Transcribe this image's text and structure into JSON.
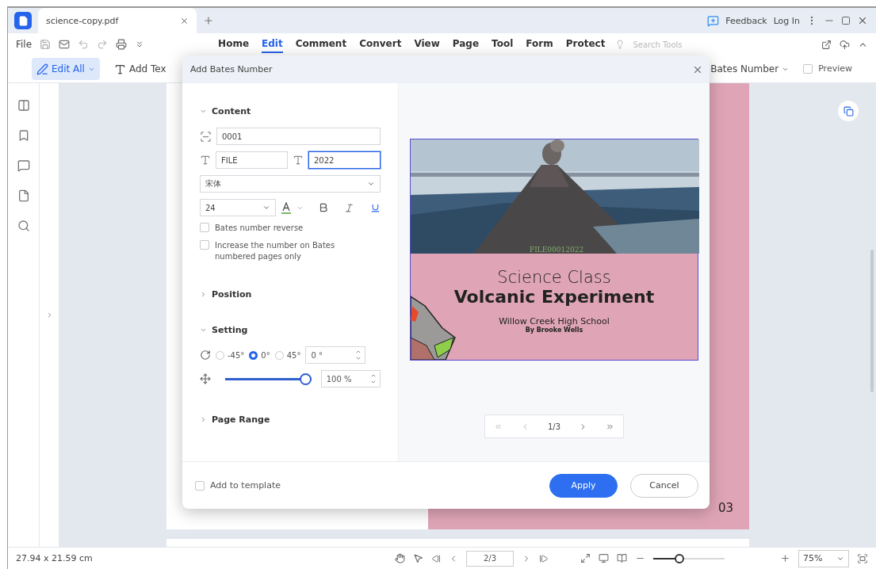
{
  "window": {
    "tab_title": "science-copy.pdf",
    "links": [
      "Feedback",
      "Log In"
    ]
  },
  "menu": {
    "file": "File",
    "tabs": [
      {
        "label": "Home",
        "selected": false
      },
      {
        "label": "Edit",
        "selected": true
      },
      {
        "label": "Comment",
        "selected": false
      },
      {
        "label": "Convert",
        "selected": false
      },
      {
        "label": "View",
        "selected": false
      },
      {
        "label": "Page",
        "selected": false
      },
      {
        "label": "Tool",
        "selected": false
      },
      {
        "label": "Form",
        "selected": false
      },
      {
        "label": "Protect",
        "selected": false
      }
    ],
    "search_placeholder": "Search Tools"
  },
  "toolbar": {
    "edit_all": {
      "label": "Edit All",
      "selected": true
    },
    "add_text": "Add Tex",
    "bates": "Bates Number",
    "preview": {
      "label": "Preview",
      "checked": false
    }
  },
  "dialog": {
    "title": "Add Bates Number",
    "content": {
      "label": "Content",
      "expanded": true,
      "number": "0001",
      "prefix": "FILE",
      "suffix": "2022",
      "font": "宋体",
      "size": "24",
      "checkboxes": [
        {
          "label": "Bates number reverse",
          "checked": false
        },
        {
          "label": "Increase the number on Bates numbered pages only",
          "checked": false
        }
      ]
    },
    "position": {
      "label": "Position",
      "expanded": false
    },
    "setting": {
      "label": "Setting",
      "expanded": true,
      "rotations": [
        {
          "label": "-45°",
          "selected": false
        },
        {
          "label": "0°",
          "selected": true
        },
        {
          "label": "45°",
          "selected": false
        }
      ],
      "angle": "0 °",
      "opacity": {
        "level": 1,
        "reading": "100 %"
      }
    },
    "page_range": {
      "label": "Page Range",
      "expanded": false
    },
    "preview": {
      "stamp": "FILE00012022",
      "title": "Science Class",
      "heading": "Volcanic Experiment",
      "school": "Willow Creek High School",
      "author": "By Brooke Wells",
      "pager": "1/3"
    },
    "footer": {
      "template": {
        "label": "Add to template",
        "checked": false
      },
      "buttons": [
        {
          "label": "Apply",
          "kind": "primary"
        },
        {
          "label": "Cancel",
          "kind": "secondary"
        }
      ]
    }
  },
  "document": {
    "page_number": "03"
  },
  "status_bar": {
    "size": "27.94 x 21.59 cm",
    "page": "2/3",
    "zoom": {
      "level": 0.35,
      "reading": "75%"
    }
  }
}
